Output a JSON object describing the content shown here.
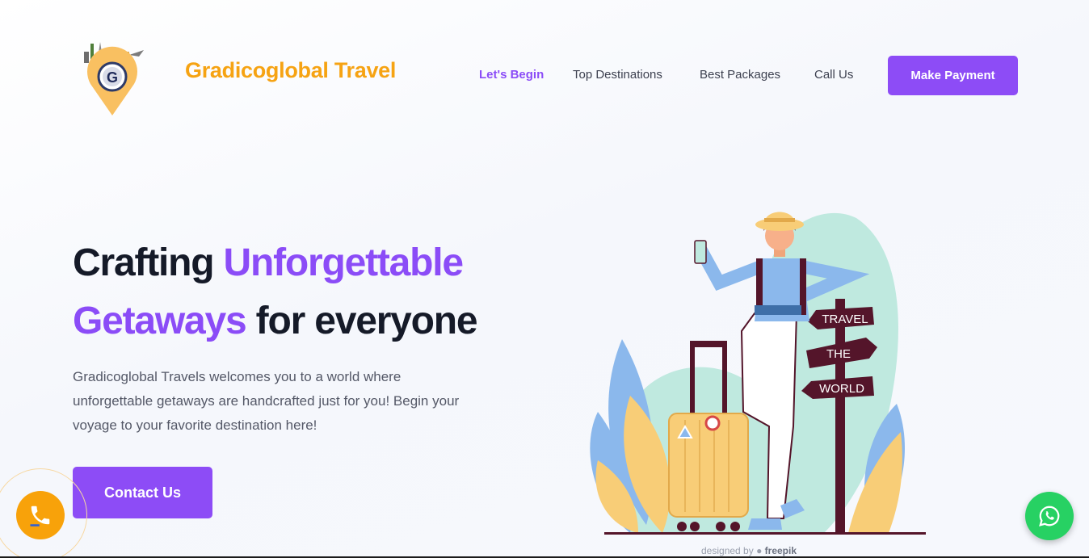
{
  "header": {
    "brand": "Gradicoglobal Travel",
    "nav": [
      "Let's Begin",
      "Top Destinations",
      "Best Packages",
      "Call Us"
    ],
    "active_nav": "Let's Begin",
    "cta": "Make Payment"
  },
  "hero": {
    "title_part1": "Crafting ",
    "title_highlight1": "Unforgettable",
    "title_highlight2": "Getaways",
    "title_part2": " for everyone",
    "description": "Gradicoglobal Travels welcomes you to a world where unforgettable getaways are handcrafted just for you! Begin your voyage to your favorite destination here!",
    "cta": "Contact Us"
  },
  "illustration": {
    "sign_labels": [
      "TRAVEL",
      "THE",
      "WORLD"
    ],
    "credit_prefix": "designed by",
    "credit_brand": "freepik"
  },
  "logo": {
    "letter": "G"
  },
  "colors": {
    "accent": "#8d4cf6",
    "brand": "#f6a313",
    "whatsapp": "#27d163",
    "call": "#f8a20a"
  },
  "icons": [
    "phone-icon",
    "whatsapp-icon",
    "freepik-icon"
  ]
}
